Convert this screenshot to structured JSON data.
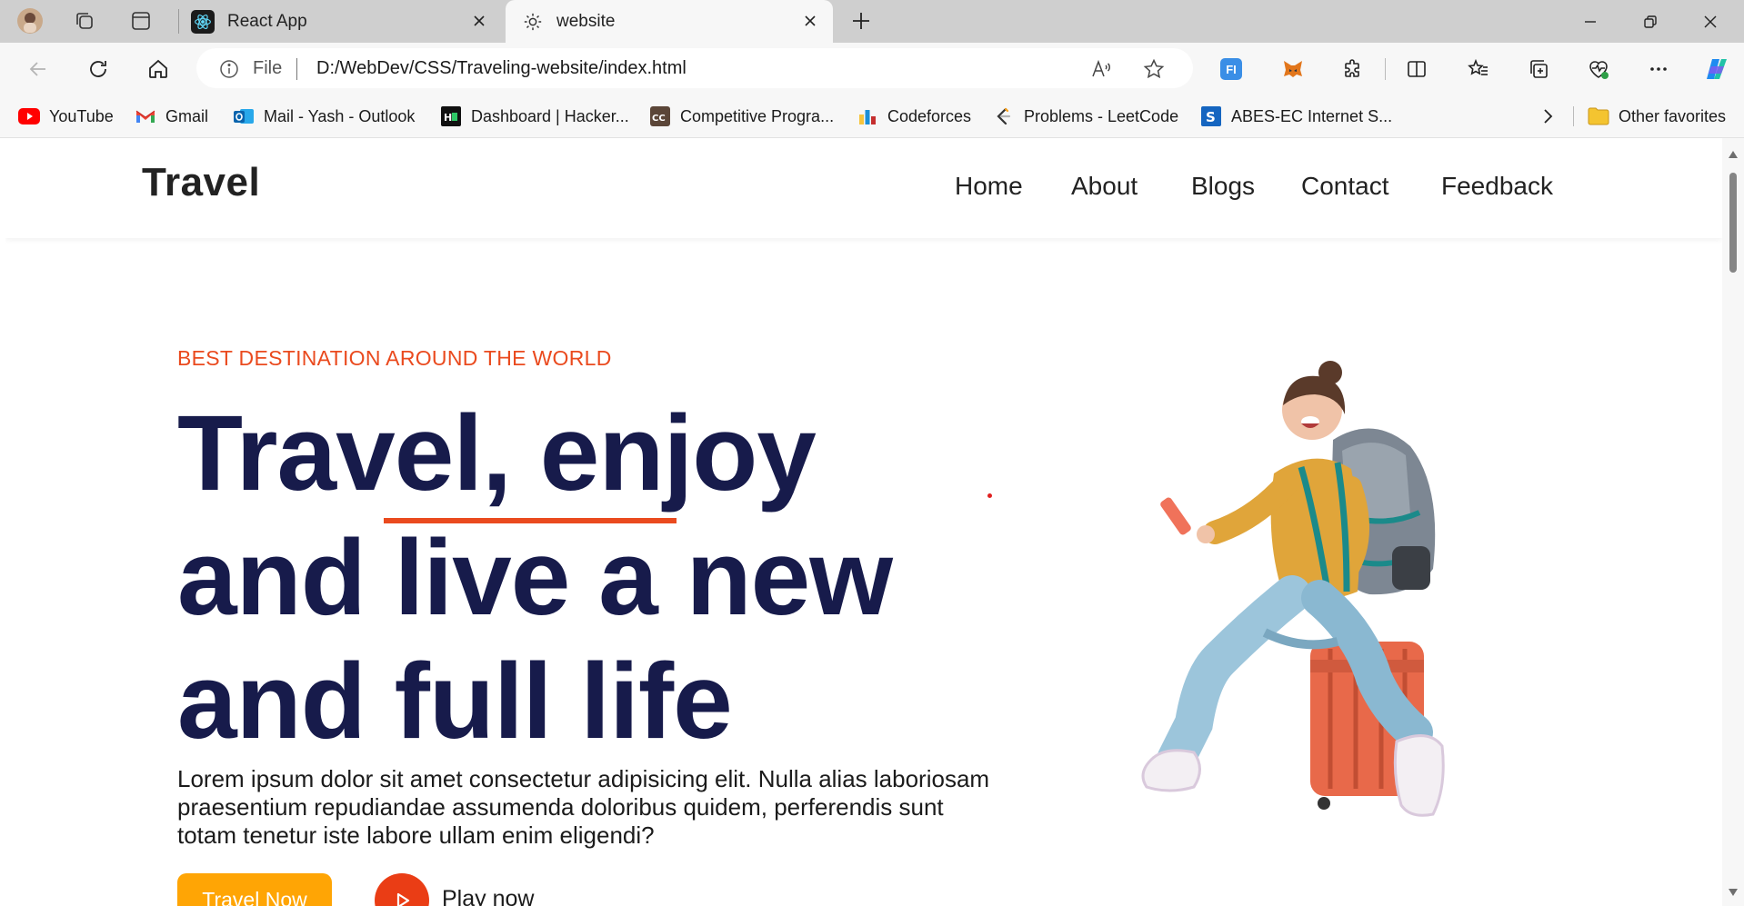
{
  "browser": {
    "tabs": [
      {
        "title": "React App",
        "active": false
      },
      {
        "title": "website",
        "active": true
      }
    ],
    "address": {
      "scheme_label": "File",
      "url": "D:/WebDev/CSS/Traveling-website/index.html"
    },
    "favorites": [
      {
        "label": "YouTube",
        "icon": "youtube-icon"
      },
      {
        "label": "Gmail",
        "icon": "gmail-icon"
      },
      {
        "label": "Mail - Yash - Outlook",
        "icon": "outlook-icon"
      },
      {
        "label": "Dashboard | Hacker...",
        "icon": "hackerrank-icon"
      },
      {
        "label": "Competitive Progra...",
        "icon": "codechef-icon"
      },
      {
        "label": "Codeforces",
        "icon": "codeforces-icon"
      },
      {
        "label": "Problems - LeetCode",
        "icon": "leetcode-icon"
      },
      {
        "label": "ABES-EC Internet S...",
        "icon": "abes-icon"
      }
    ],
    "other_favorites": "Other favorites"
  },
  "site": {
    "logo": "Travel",
    "nav": [
      "Home",
      "About",
      "Blogs",
      "Contact",
      "Feedback"
    ],
    "hero": {
      "kicker": "BEST DESTINATION AROUND THE WORLD",
      "title_part1": "Travel,",
      "title_highlight": "enjoy",
      "title_line2": "and live a new",
      "title_line3": "and full life",
      "description": "Lorem ipsum dolor sit amet consectetur adipisicing elit. Nulla alias laboriosam praesentium repudiandae assumenda doloribus quidem, perferendis sunt totam tenetur iste labore ullam enim eligendi?",
      "cta_primary": "Travel Now",
      "cta_secondary": "Play now"
    }
  },
  "colors": {
    "accent_orange": "#ea4a1e",
    "heading_navy": "#171b4b",
    "button_yellow": "#ffa505"
  }
}
